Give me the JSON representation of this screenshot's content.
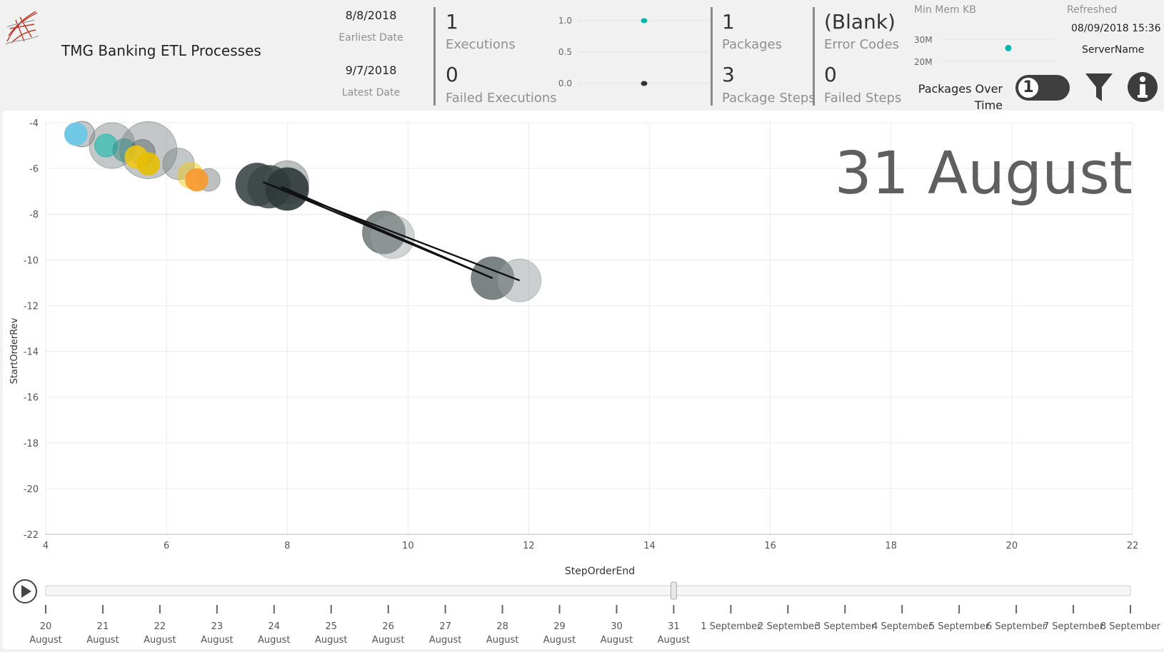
{
  "header": {
    "title": "TMG Banking ETL Processes",
    "earliest_date": "8/8/2018",
    "earliest_label": "Earliest Date",
    "latest_date": "9/7/2018",
    "latest_label": "Latest Date"
  },
  "kpis": {
    "executions_value": "1",
    "executions_label": "Executions",
    "failed_exec_value": "0",
    "failed_exec_label": "Failed Executions",
    "packages_value": "1",
    "packages_label": "Packages",
    "package_steps_value": "3",
    "package_steps_label": "Package Steps",
    "error_codes_value": "(Blank)",
    "error_codes_label": "Error Codes",
    "failed_steps_value": "0",
    "failed_steps_label": "Failed Steps"
  },
  "mini_chart": {
    "ticks": [
      "1.0",
      "0.5",
      "0.0"
    ],
    "points": [
      1.0,
      0.0
    ],
    "colors": [
      "#01b8aa",
      "#333333"
    ]
  },
  "mem_chart": {
    "title": "Min Mem KB",
    "ticks": [
      "30M",
      "20M"
    ],
    "point": 26,
    "color": "#01b8aa"
  },
  "refresh": {
    "label": "Refreshed",
    "value": "08/09/2018 15:36",
    "server": "ServerName"
  },
  "controls": {
    "toggle_label_line1": "Packages Over",
    "toggle_label_line2": "Time",
    "toggle_value": "1",
    "filter_icon": "filter-icon",
    "info_icon": "info-icon"
  },
  "chart_data": {
    "type": "scatter",
    "title": "",
    "xlabel": "StepOrderEnd",
    "ylabel": "StartOrderRev",
    "xlim": [
      4,
      22
    ],
    "ylim": [
      -22,
      -4
    ],
    "x_ticks": [
      "4",
      "6",
      "8",
      "10",
      "12",
      "14",
      "16",
      "18",
      "20",
      "22"
    ],
    "y_ticks": [
      "-4",
      "-6",
      "-8",
      "-10",
      "-12",
      "-14",
      "-16",
      "-18",
      "-20",
      "-22"
    ],
    "grid": true,
    "play_axis_label": "31 August",
    "bubbles": [
      {
        "x": 4.6,
        "y": -4.5,
        "size": 18,
        "color": "#555f5f",
        "opacity": 0.35
      },
      {
        "x": 4.5,
        "y": -4.5,
        "size": 16,
        "color": "#70c7e6",
        "opacity": 1.0
      },
      {
        "x": 5.1,
        "y": -5.0,
        "size": 32,
        "color": "#7a8282",
        "opacity": 0.45
      },
      {
        "x": 5.7,
        "y": -5.2,
        "size": 40,
        "color": "#7a8282",
        "opacity": 0.45
      },
      {
        "x": 5.0,
        "y": -5.0,
        "size": 16,
        "color": "#01b8aa",
        "opacity": 0.55
      },
      {
        "x": 5.3,
        "y": -5.2,
        "size": 16,
        "color": "#3e8e86",
        "opacity": 0.55
      },
      {
        "x": 5.6,
        "y": -5.3,
        "size": 18,
        "color": "#555f5f",
        "opacity": 0.45
      },
      {
        "x": 5.5,
        "y": -5.5,
        "size": 16,
        "color": "#f2c80f",
        "opacity": 0.85
      },
      {
        "x": 5.7,
        "y": -5.8,
        "size": 16,
        "color": "#e6be00",
        "opacity": 0.9
      },
      {
        "x": 6.2,
        "y": -5.8,
        "size": 22,
        "color": "#7a8282",
        "opacity": 0.45
      },
      {
        "x": 6.4,
        "y": -6.3,
        "size": 18,
        "color": "#f2c80f",
        "opacity": 0.45
      },
      {
        "x": 6.7,
        "y": -6.5,
        "size": 16,
        "color": "#7a8282",
        "opacity": 0.5
      },
      {
        "x": 6.5,
        "y": -6.5,
        "size": 16,
        "color": "#f79c34",
        "opacity": 0.95
      },
      {
        "x": 7.5,
        "y": -6.7,
        "size": 30,
        "color": "#3d4747",
        "opacity": 0.9
      },
      {
        "x": 8.0,
        "y": -6.6,
        "size": 30,
        "color": "#7a8282",
        "opacity": 0.5
      },
      {
        "x": 7.7,
        "y": -6.8,
        "size": 30,
        "color": "#3d4747",
        "opacity": 0.85
      },
      {
        "x": 8.0,
        "y": -6.9,
        "size": 30,
        "color": "#2e3838",
        "opacity": 0.9
      },
      {
        "x": 9.6,
        "y": -8.8,
        "size": 30,
        "color": "#5a6464",
        "opacity": 0.75
      },
      {
        "x": 9.75,
        "y": -9.0,
        "size": 30,
        "color": "#9aa0a0",
        "opacity": 0.45
      },
      {
        "x": 11.4,
        "y": -10.8,
        "size": 30,
        "color": "#5a6464",
        "opacity": 0.8
      },
      {
        "x": 11.85,
        "y": -10.9,
        "size": 30,
        "color": "#9aa0a0",
        "opacity": 0.5
      }
    ],
    "trails": [
      {
        "x1": 7.6,
        "y1": -6.6,
        "x2": 11.85,
        "y2": -10.9
      },
      {
        "x1": 7.7,
        "y1": -6.7,
        "x2": 11.4,
        "y2": -10.8
      },
      {
        "x1": 7.9,
        "y1": -6.8,
        "x2": 11.4,
        "y2": -10.8
      }
    ]
  },
  "play_axis": {
    "play_icon": "play-icon",
    "current_index": 11,
    "dates": [
      [
        "20",
        "August"
      ],
      [
        "21",
        "August"
      ],
      [
        "22",
        "August"
      ],
      [
        "23",
        "August"
      ],
      [
        "24",
        "August"
      ],
      [
        "25",
        "August"
      ],
      [
        "26",
        "August"
      ],
      [
        "27",
        "August"
      ],
      [
        "28",
        "August"
      ],
      [
        "29",
        "August"
      ],
      [
        "30",
        "August"
      ],
      [
        "31",
        "August"
      ],
      [
        "1 September",
        ""
      ],
      [
        "2 September",
        ""
      ],
      [
        "3 September",
        ""
      ],
      [
        "4 September",
        ""
      ],
      [
        "5 September",
        ""
      ],
      [
        "6 September",
        ""
      ],
      [
        "7 September",
        ""
      ],
      [
        "8 September",
        ""
      ]
    ]
  }
}
